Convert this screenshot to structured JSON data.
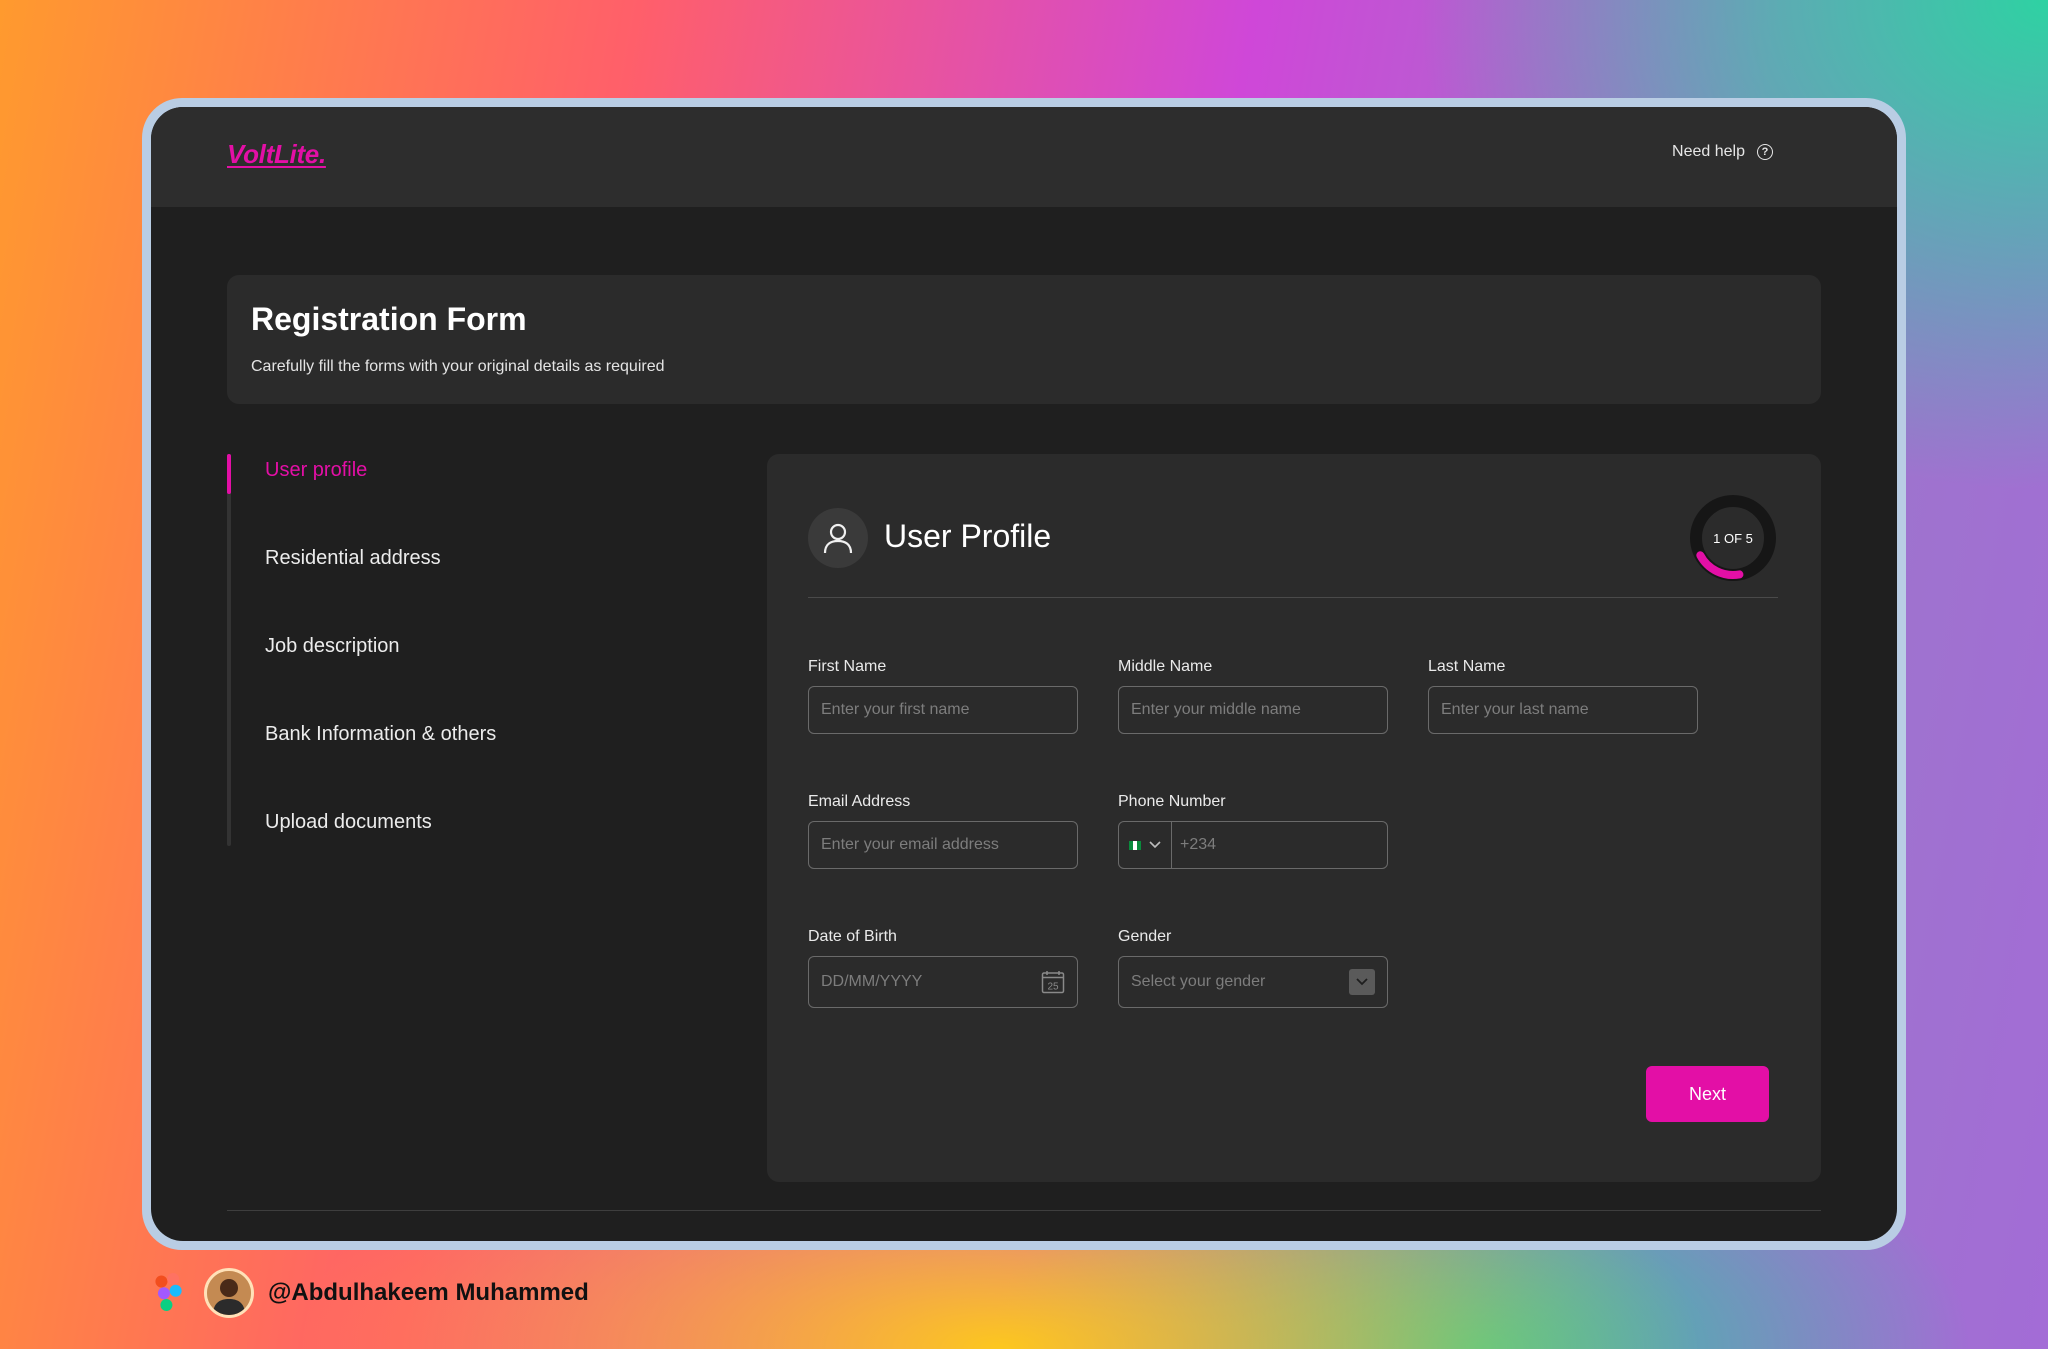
{
  "brand": {
    "logo": "VoltLite.",
    "accent": "#E30FA6"
  },
  "topbar": {
    "help_label": "Need help",
    "help_icon": "question-circle-icon"
  },
  "header": {
    "title": "Registration Form",
    "subtitle": "Carefully fill the forms with your original details as required"
  },
  "steps": [
    {
      "label": "User profile",
      "active": true
    },
    {
      "label": "Residential address",
      "active": false
    },
    {
      "label": "Job description",
      "active": false
    },
    {
      "label": "Bank Information & others",
      "active": false
    },
    {
      "label": "Upload documents",
      "active": false
    }
  ],
  "form": {
    "title": "User Profile",
    "progress_text": "1 OF 5",
    "progress_fraction": 0.2,
    "fields": {
      "first_name": {
        "label": "First Name",
        "placeholder": "Enter your first name"
      },
      "middle_name": {
        "label": "Middle Name",
        "placeholder": "Enter your middle name"
      },
      "last_name": {
        "label": "Last Name",
        "placeholder": "Enter your last name"
      },
      "email": {
        "label": "Email Address",
        "placeholder": "Enter your email address"
      },
      "phone": {
        "label": "Phone Number",
        "placeholder": "+234",
        "flag": "nigeria-flag-icon"
      },
      "dob": {
        "label": "Date of Birth",
        "placeholder": "DD/MM/YYYY",
        "icon": "calendar-icon",
        "icon_text": "25"
      },
      "gender": {
        "label": "Gender",
        "placeholder": "Select your gender",
        "icon": "chevron-down-icon"
      }
    },
    "next_label": "Next"
  },
  "credit": {
    "name": "@Abdulhakeem Muhammed"
  }
}
